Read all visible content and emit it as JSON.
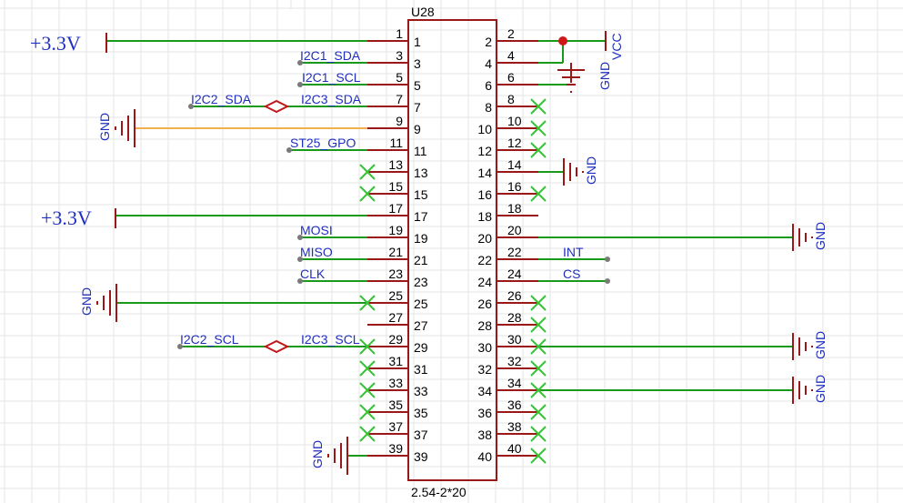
{
  "component": {
    "designator": "U28",
    "value": "2.54-2*20",
    "left_pins": [
      "1",
      "3",
      "5",
      "7",
      "9",
      "11",
      "13",
      "15",
      "17",
      "19",
      "21",
      "23",
      "25",
      "27",
      "29",
      "31",
      "33",
      "35",
      "37",
      "39"
    ],
    "right_pins": [
      "2",
      "4",
      "6",
      "8",
      "10",
      "12",
      "14",
      "16",
      "18",
      "20",
      "22",
      "24",
      "26",
      "28",
      "30",
      "32",
      "34",
      "36",
      "38",
      "40"
    ]
  },
  "nets": {
    "pin1": "+3.3V",
    "pin17": "+3.3V",
    "pin3": "I2C1_SDA",
    "pin5": "I2C1_SCL",
    "pin7": "I2C3_SDA",
    "pin7_port": "I2C2_SDA",
    "pin11": "ST25_GPO",
    "pin19": "MOSI",
    "pin21": "MISO",
    "pin23": "CLK",
    "pin29": "I2C3_SCL",
    "pin29_port": "I2C2_SCL",
    "pin22": "INT",
    "pin24": "CS",
    "vcc": "VCC",
    "gnd": "GND"
  },
  "colors": {
    "pin": "#9a1818",
    "wire": "#1a9a1a",
    "net_label": "#1f2fbf",
    "no_connect": "#35c435",
    "junction": "#d01818",
    "orange_wire": "#f2b04a"
  }
}
